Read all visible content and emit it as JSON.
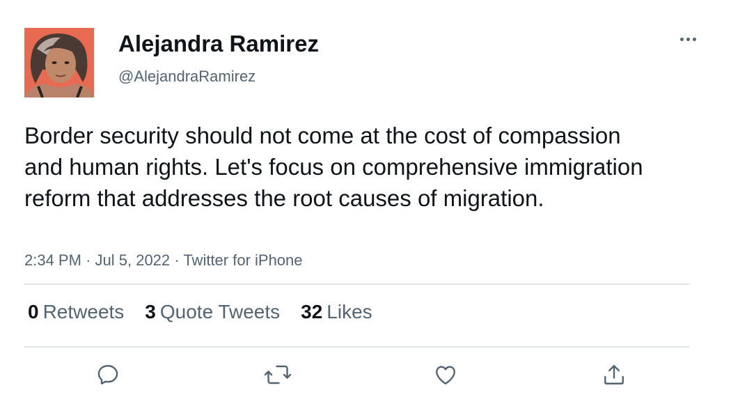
{
  "user": {
    "display_name": "Alejandra Ramirez",
    "handle": "@AlejandraRamirez",
    "avatar_bg": "#e96a53"
  },
  "tweet": {
    "text": "Border security should not come at the cost of compassion and human rights. Let's focus on comprehensive immigration reform that addresses the root causes of migration.",
    "time": "2:34 PM",
    "date": "Jul 5, 2022",
    "source": "Twitter for iPhone",
    "separator": "·"
  },
  "stats": {
    "retweets": {
      "count": "0",
      "label": "Retweets"
    },
    "quotes": {
      "count": "3",
      "label": "Quote Tweets"
    },
    "likes": {
      "count": "32",
      "label": "Likes"
    }
  },
  "actions": {
    "reply_icon": "reply-icon",
    "retweet_icon": "retweet-icon",
    "like_icon": "heart-icon",
    "share_icon": "share-icon"
  },
  "colors": {
    "text": "#0f1419",
    "secondary": "#536471",
    "divider": "#dfe3e6"
  }
}
